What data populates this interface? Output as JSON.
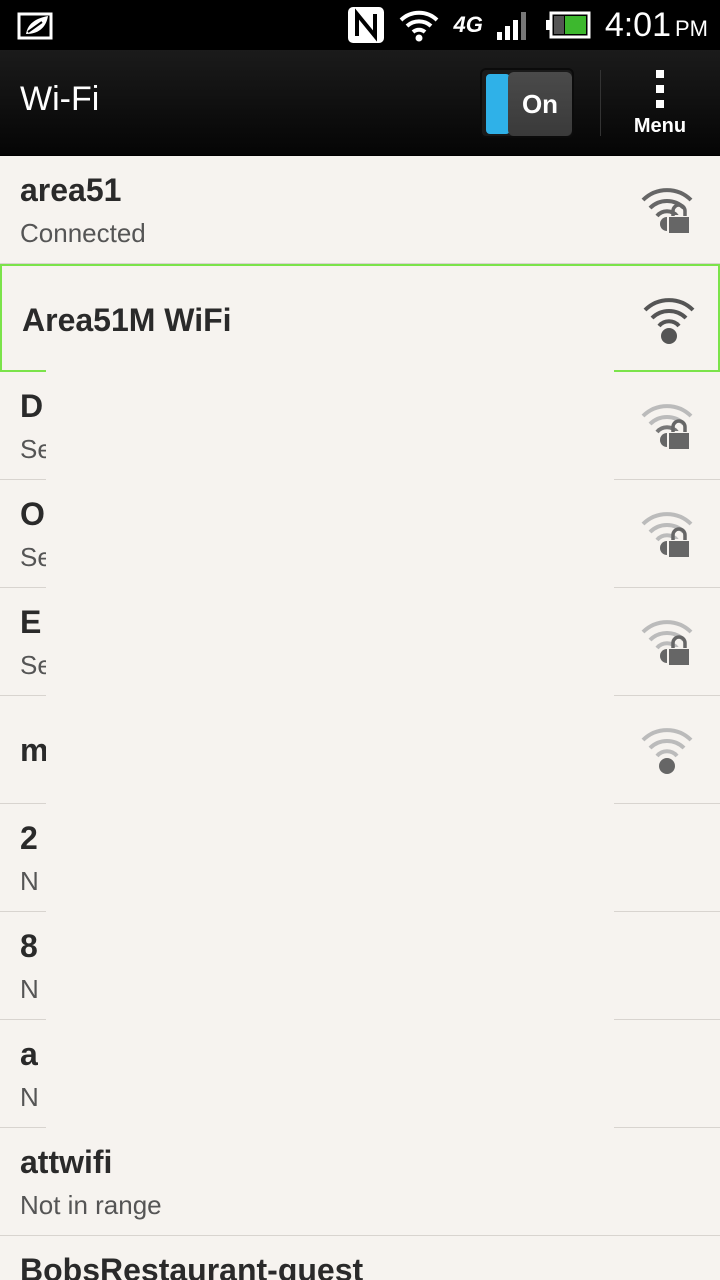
{
  "status_bar": {
    "time": "4:01",
    "ampm": "PM",
    "network": "4G LTE",
    "icons": [
      "leaf-icon",
      "nfc-icon",
      "wifi-icon",
      "4g-lte-icon",
      "signal-icon",
      "battery-icon"
    ]
  },
  "action_bar": {
    "title": "Wi-Fi",
    "toggle_label": "On",
    "menu_label": "Menu"
  },
  "networks": [
    {
      "name": "area51",
      "status": "Connected",
      "secured": true,
      "signal": "strong"
    },
    {
      "name": "Area51M WiFi",
      "status": "",
      "secured": false,
      "signal": "strong"
    },
    {
      "name": "D",
      "status": "Se",
      "secured": true,
      "signal": "weak"
    },
    {
      "name": "O",
      "status": "Se",
      "secured": true,
      "signal": "weak"
    },
    {
      "name": "E",
      "status": "Se",
      "secured": true,
      "signal": "weak"
    },
    {
      "name": "m",
      "status": "",
      "secured": false,
      "signal": "weak"
    },
    {
      "name": "2",
      "status": "N",
      "secured": false,
      "signal": "none"
    },
    {
      "name": "8",
      "status": "N",
      "secured": false,
      "signal": "none"
    },
    {
      "name": "a",
      "status": "N",
      "secured": false,
      "signal": "none"
    },
    {
      "name": "attwifi",
      "status": "Not in range",
      "secured": false,
      "signal": "none"
    },
    {
      "name": "BobsRestaurant-guest",
      "status": "",
      "secured": false,
      "signal": "none"
    }
  ],
  "colors": {
    "toggle_on": "#2fb1e8",
    "highlight": "#7be34a",
    "background": "#f6f3ef"
  }
}
